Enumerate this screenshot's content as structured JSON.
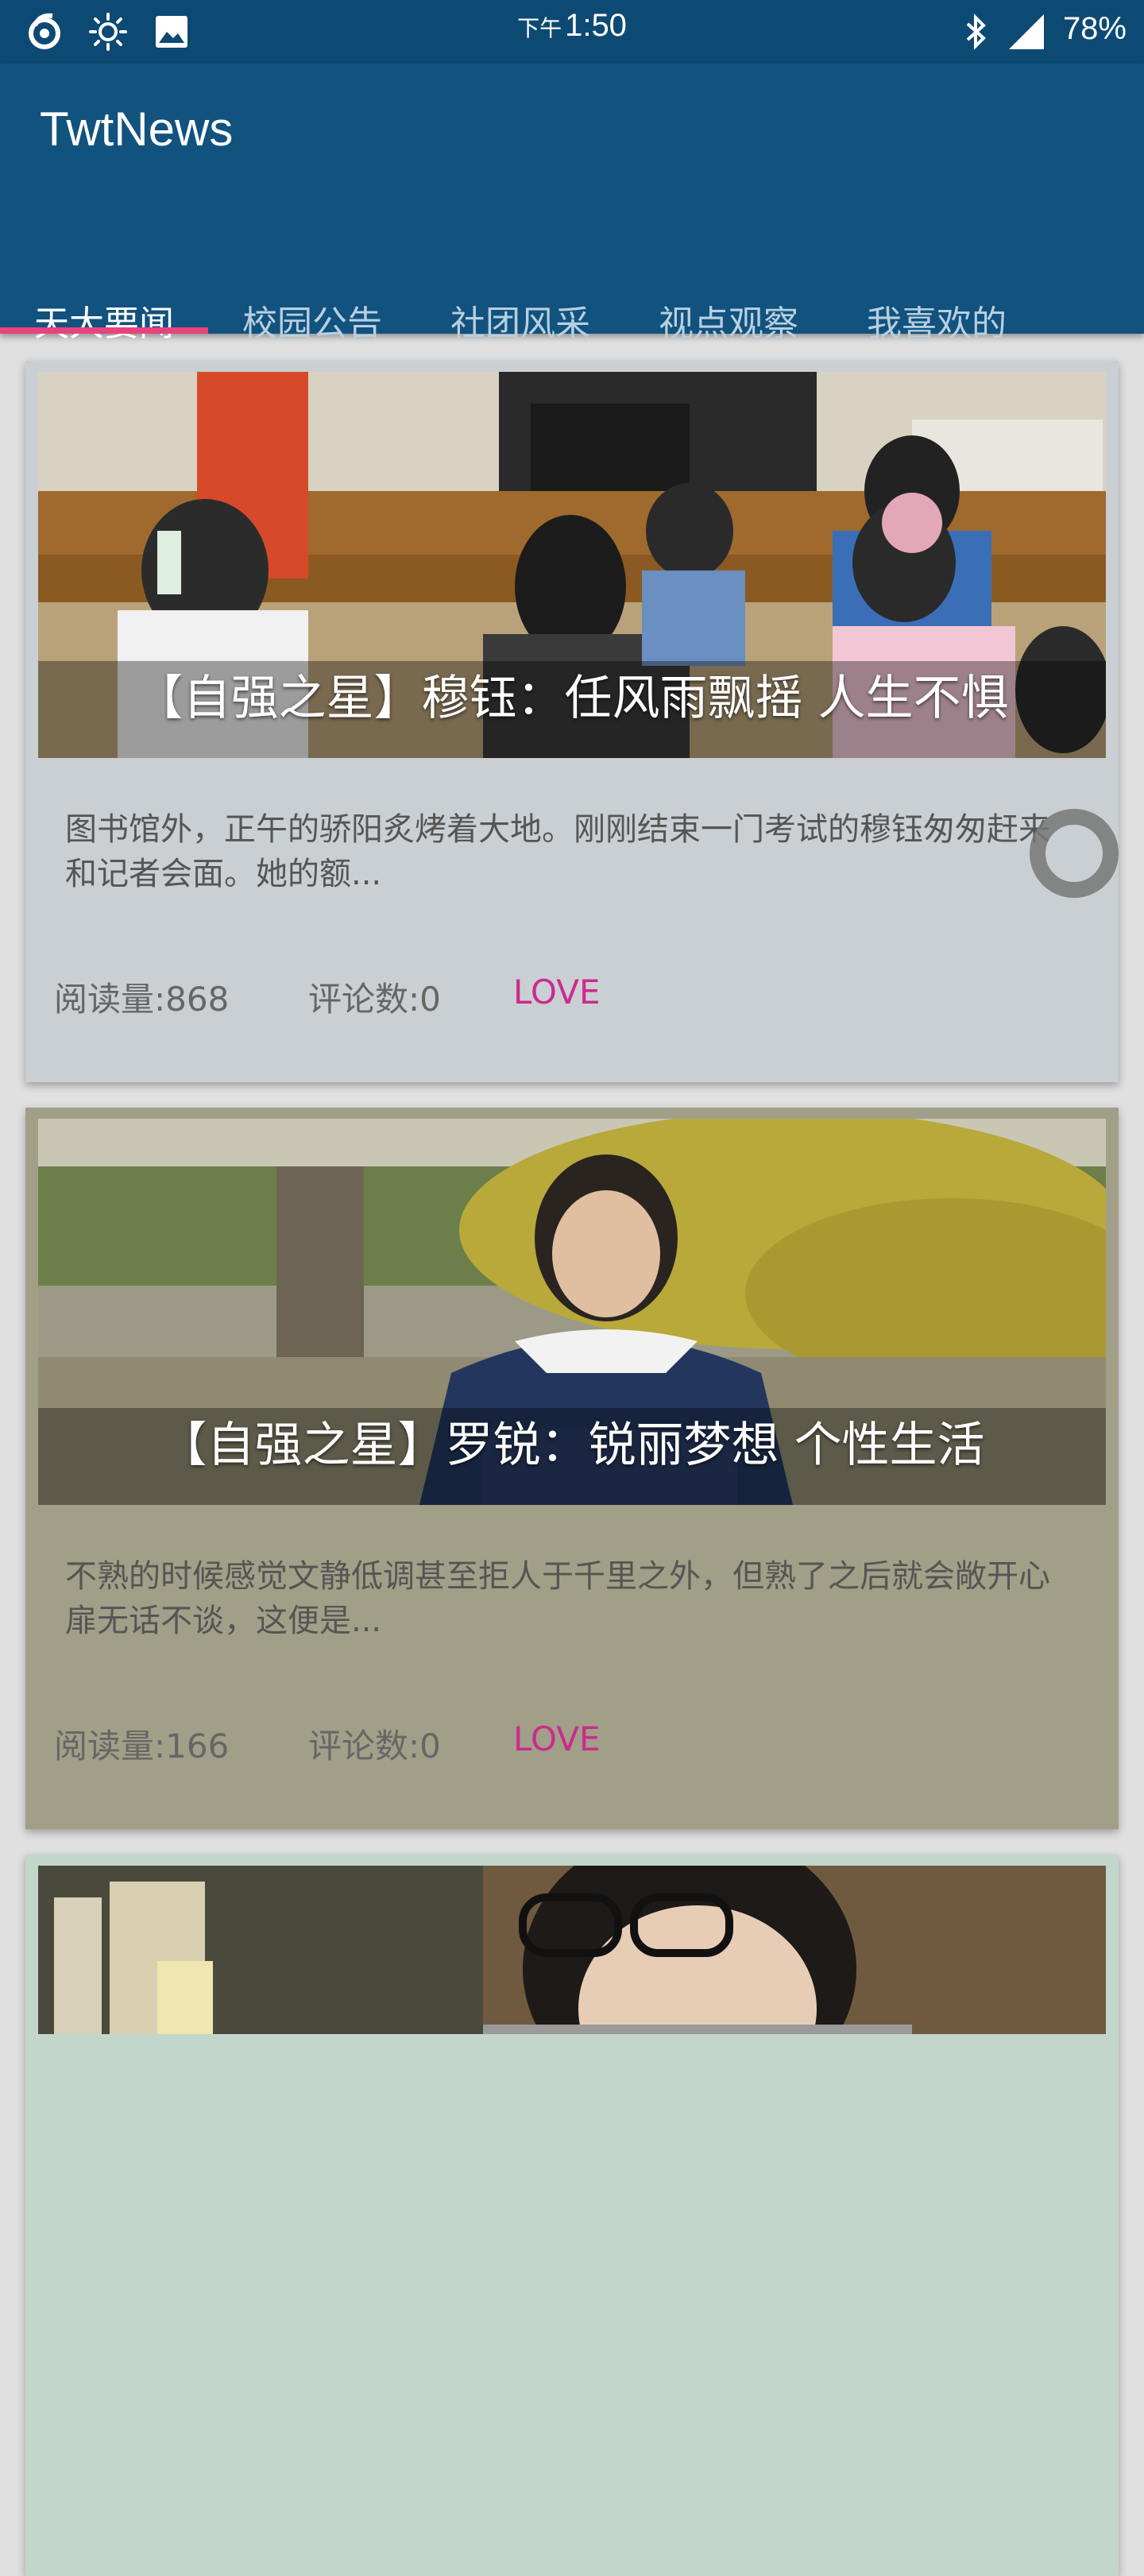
{
  "status_bar": {
    "ampm": "下午",
    "time": "1:50",
    "battery": "78%"
  },
  "app_bar": {
    "title": "TwtNews"
  },
  "tabs": [
    {
      "label": "天大要闻",
      "active": true
    },
    {
      "label": "校园公告",
      "active": false
    },
    {
      "label": "社团风采",
      "active": false
    },
    {
      "label": "视点观察",
      "active": false
    },
    {
      "label": "我喜欢的",
      "active": false
    }
  ],
  "articles": [
    {
      "title": "【自强之星】穆钰：任风雨飘摇 人生不惧",
      "excerpt": "图书馆外，正午的骄阳炙烤着大地。刚刚结束一门考试的穆钰匆匆赶来和记者会面。她的额...",
      "views": "阅读量:868",
      "comments": "评论数:0",
      "love": "LOVE",
      "card_color": "#c9cfd2"
    },
    {
      "title": "【自强之星】罗锐：锐丽梦想 个性生活",
      "excerpt": "不熟的时候感觉文静低调甚至拒人于千里之外，但熟了之后就会敞开心扉无话不谈，这便是...",
      "views": "阅读量:166",
      "comments": "评论数:0",
      "love": "LOVE",
      "card_color": "#a19f87"
    }
  ]
}
